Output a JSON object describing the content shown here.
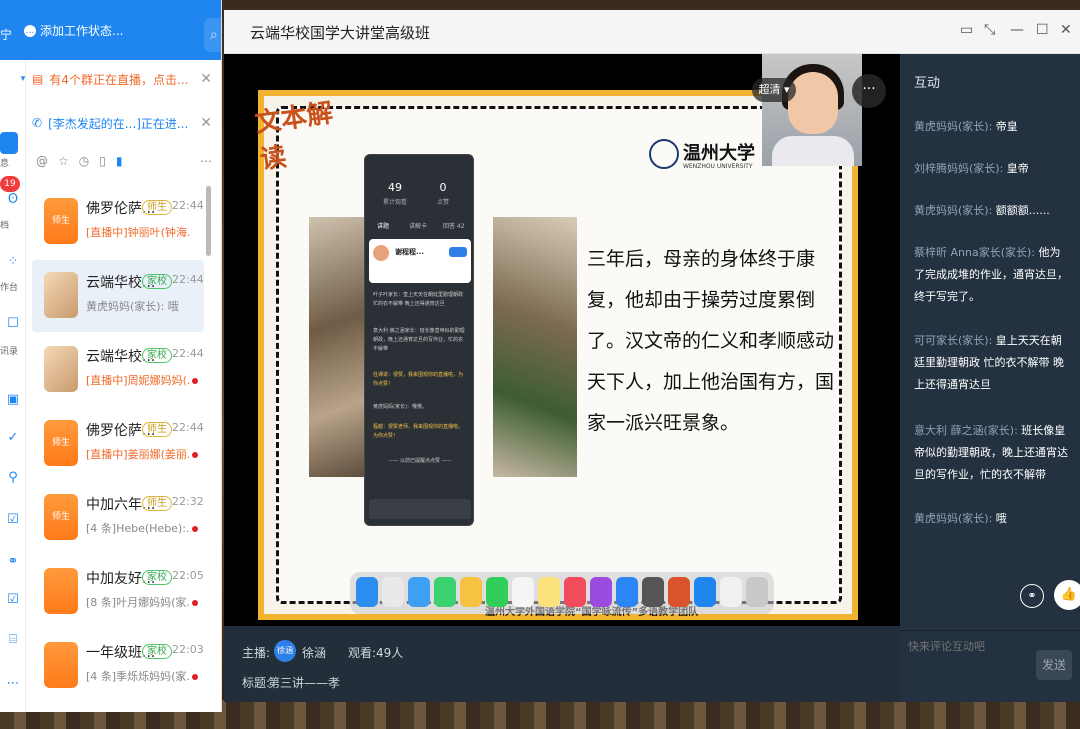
{
  "chat_app": {
    "user_fragment": "宁",
    "status_label": "添加工作状态...",
    "rail_badge": "19",
    "rail_badge2": "2",
    "rail_labels": [
      "息",
      "档",
      "作台",
      "讯录"
    ],
    "banners": [
      {
        "text": "有4个群正在直播，点击...",
        "color": "#f06a2a"
      },
      {
        "text": "[李杰发起的在...]正在进...",
        "color": "#1f86f0"
      }
    ],
    "conversations": [
      {
        "name": "佛罗伦萨...",
        "tag": "师生",
        "time": "22:44",
        "sub": "[直播中]钟丽叶(钟海...",
        "live": true,
        "avatar": "师生"
      },
      {
        "name": "云端华校...",
        "tag": "家校",
        "time": "22:44",
        "sub": "黄虎妈妈(家长): 哦",
        "live": false,
        "avatar": ""
      },
      {
        "name": "云端华校...",
        "tag": "家校",
        "time": "22:44",
        "sub": "[直播中]周妮娜妈妈(...",
        "live": true,
        "avatar": ""
      },
      {
        "name": "佛罗伦萨...",
        "tag": "师生",
        "time": "22:44",
        "sub": "[直播中]姜丽娜(姜丽...",
        "live": true,
        "avatar": "师生"
      },
      {
        "name": "中加六年...",
        "tag": "师生",
        "time": "22:32",
        "sub": "[4 条]Hebe(Hebe):...",
        "live": false,
        "avatar": "师生"
      },
      {
        "name": "中加友好...",
        "tag": "家校",
        "time": "22:05",
        "sub": "[8 条]叶月娜妈妈(家...",
        "live": false,
        "avatar": ""
      },
      {
        "name": "一年级班...",
        "tag": "家校",
        "time": "22:03",
        "sub": "[4 条]季烁烁妈妈(家...",
        "live": false,
        "avatar": ""
      }
    ]
  },
  "live_window": {
    "title": "云端华校国学大讲堂高级班",
    "quality": "超清",
    "slide": {
      "ribbon": "文本解读",
      "university": "温州大学",
      "university_en": "WENZHOU UNIVERSITY",
      "body": "三年后，母亲的身体终于康复，他却由于操劳过度累倒了。汉文帝的仁义和孝顺感动天下人，加上他治国有方，国家一派兴旺景象。",
      "footer": "温州大学外国语学院“国学咏流传”多语教学团队"
    },
    "phone": {
      "stats": [
        {
          "value": "49",
          "label": "累计观看"
        },
        {
          "value": "0",
          "label": "点赞"
        }
      ],
      "tabs": [
        "讲题",
        "讲解卡",
        "回答 42"
      ],
      "card_name": "谢程程...",
      "messages": [
        {
          "text": "叶子叶家长：皇上天天在朝廷里勤理朝政 忙的衣不解带 晚上还得通宵达旦",
          "hl": false
        },
        {
          "text": "意大利 薛之涵家长：班长像皇帝似的勤理朝政，晚上还通宵达旦的写作业，忙的衣不解带",
          "hl": false
        },
        {
          "text": "任课讲：很赞，我来围观你的直播啦，为你点赞！",
          "hl": true
        },
        {
          "text": "黄虎妈妈(家长)：哦哦。",
          "hl": false
        },
        {
          "text": "程越：很赞老师，我来围观你的直播啦，为你点赞！",
          "hl": true
        },
        {
          "text": "—— 以前已提醒点点赞 ——",
          "hl": false
        }
      ]
    },
    "host_label": "主播:",
    "host_name": "徐涵",
    "viewers_label": "观看:",
    "viewers": "49人",
    "topic_label": "标题:",
    "topic": "第三讲——孝"
  },
  "panel": {
    "title": "互动",
    "comments": [
      {
        "who": "黄虎妈妈(家长):",
        "text": "帝皇"
      },
      {
        "who": "刘梓腾妈妈(家长):",
        "text": "皇帝"
      },
      {
        "who": "黄虎妈妈(家长):",
        "text": "额额额......"
      },
      {
        "who": "蔡梓昕 Anna家长(家长):",
        "text": "他为了完成成堆的作业，通宵达旦，终于写完了。"
      },
      {
        "who": "可可家长(家长):",
        "text": "皇上天天在朝廷里勤理朝政 忙的衣不解带 晚上还得通宵达旦"
      },
      {
        "who": "意大利 薛之涵(家长):",
        "text": "班长像皇帝似的勤理朝政，晚上还通宵达旦的写作业，忙的衣不解带"
      },
      {
        "who": "黄虎妈妈(家长):",
        "text": "哦"
      }
    ],
    "input_placeholder": "快来评论互动吧",
    "send_label": "发送"
  }
}
